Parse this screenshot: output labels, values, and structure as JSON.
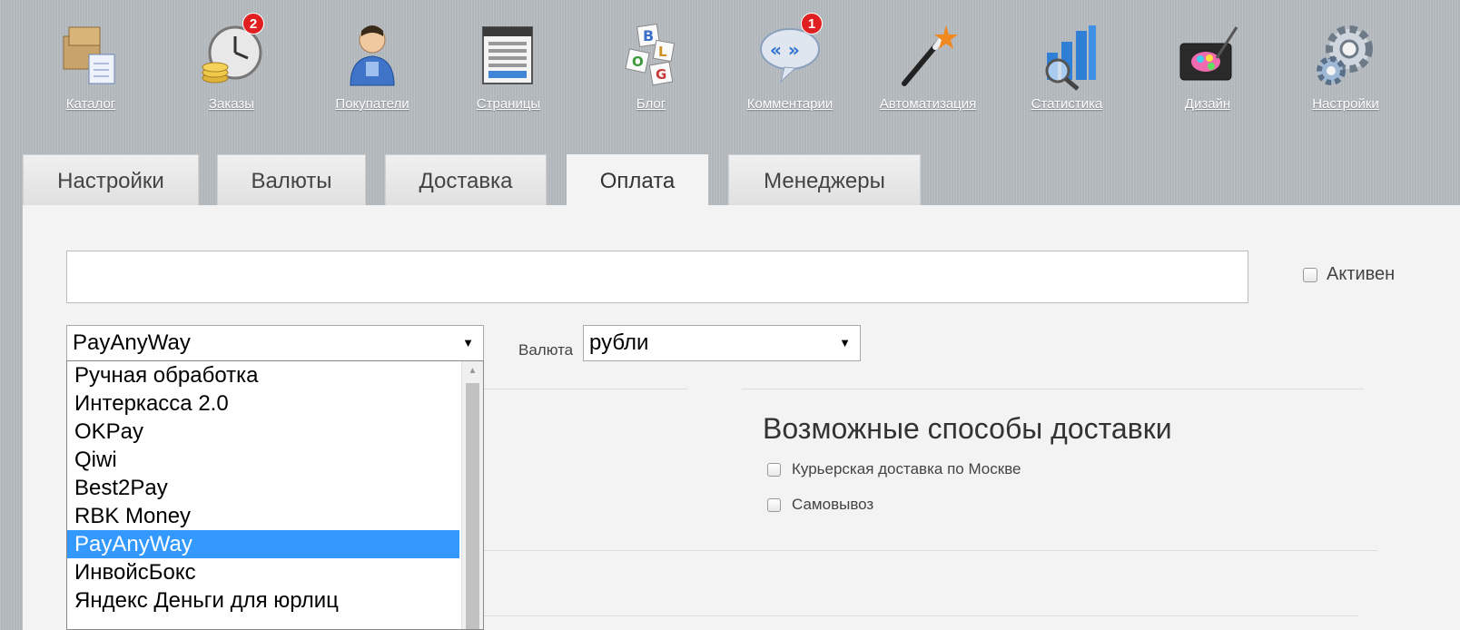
{
  "nav": [
    {
      "label": "Каталог",
      "icon": "catalog-icon",
      "badge": ""
    },
    {
      "label": "Заказы",
      "icon": "orders-clock-icon",
      "badge": "2"
    },
    {
      "label": "Покупатели",
      "icon": "customer-icon",
      "badge": ""
    },
    {
      "label": "Страницы",
      "icon": "pages-icon",
      "badge": ""
    },
    {
      "label": "Блог",
      "icon": "blog-icon",
      "badge": ""
    },
    {
      "label": "Комментарии",
      "icon": "comments-icon",
      "badge": "1"
    },
    {
      "label": "Автоматизация",
      "icon": "magic-wand-icon",
      "badge": ""
    },
    {
      "label": "Статистика",
      "icon": "statistics-icon",
      "badge": ""
    },
    {
      "label": "Дизайн",
      "icon": "design-icon",
      "badge": ""
    },
    {
      "label": "Настройки",
      "icon": "settings-gear-icon",
      "badge": ""
    }
  ],
  "tabs": [
    {
      "label": "Настройки",
      "active": false
    },
    {
      "label": "Валюты",
      "active": false
    },
    {
      "label": "Доставка",
      "active": false
    },
    {
      "label": "Оплата",
      "active": true
    },
    {
      "label": "Менеджеры",
      "active": false
    }
  ],
  "form": {
    "name_value": "",
    "active_label": "Активен",
    "payment_module_value": "PayAnyWay",
    "currency_label": "Валюта",
    "currency_value": "рубли"
  },
  "dropdown": {
    "options": [
      "Ручная обработка",
      "Интеркасса 2.0",
      "OKPay",
      "Qiwi",
      "Best2Pay",
      "RBK Money",
      "PayAnyWay",
      "ИнвойсБокс",
      "Яндекс Деньги для юрлиц"
    ],
    "selected": "PayAnyWay"
  },
  "delivery": {
    "title": "Возможные способы доставки",
    "options": [
      "Курьерская доставка по Москве",
      "Самовывоз"
    ]
  },
  "colors": {
    "accent": "#3399ff",
    "badge": "#e02020"
  }
}
